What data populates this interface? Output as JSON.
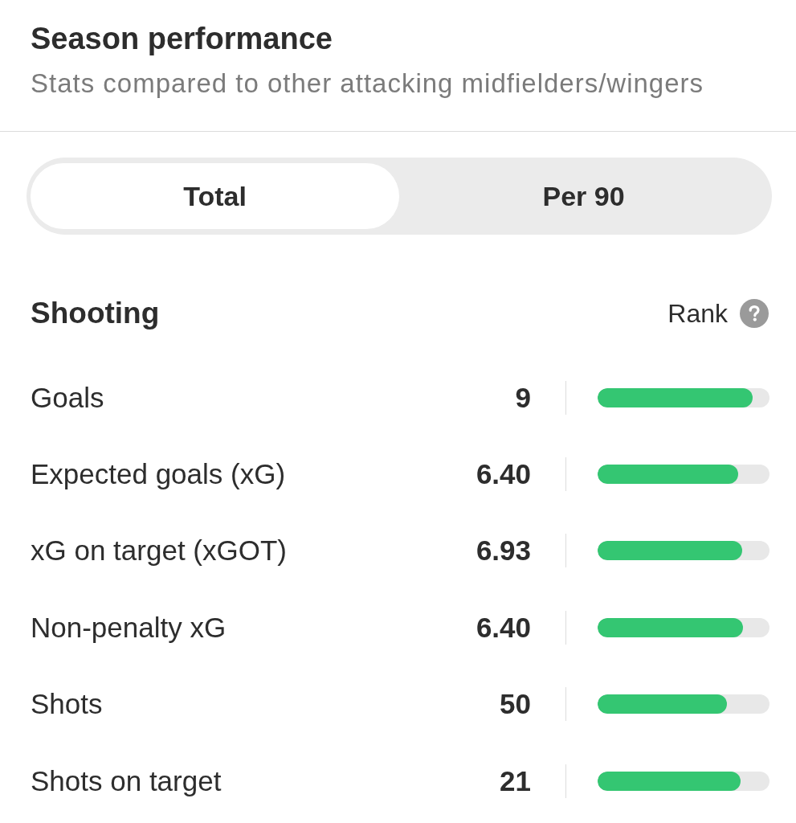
{
  "header": {
    "title": "Season performance",
    "subtitle": "Stats compared to other attacking midfielders/wingers"
  },
  "tabs": [
    {
      "label": "Total",
      "selected": true
    },
    {
      "label": "Per 90",
      "selected": false
    }
  ],
  "section": {
    "title": "Shooting",
    "rank_label": "Rank"
  },
  "stats": [
    {
      "label": "Goals",
      "value": "9",
      "level": 0.9
    },
    {
      "label": "Expected goals (xG)",
      "value": "6.40",
      "level": 0.82
    },
    {
      "label": "xG on target (xGOT)",
      "value": "6.93",
      "level": 0.84
    },
    {
      "label": "Non-penalty xG",
      "value": "6.40",
      "level": 0.845
    },
    {
      "label": "Shots",
      "value": "50",
      "level": 0.75
    },
    {
      "label": "Shots on target",
      "value": "21",
      "level": 0.83
    }
  ]
}
